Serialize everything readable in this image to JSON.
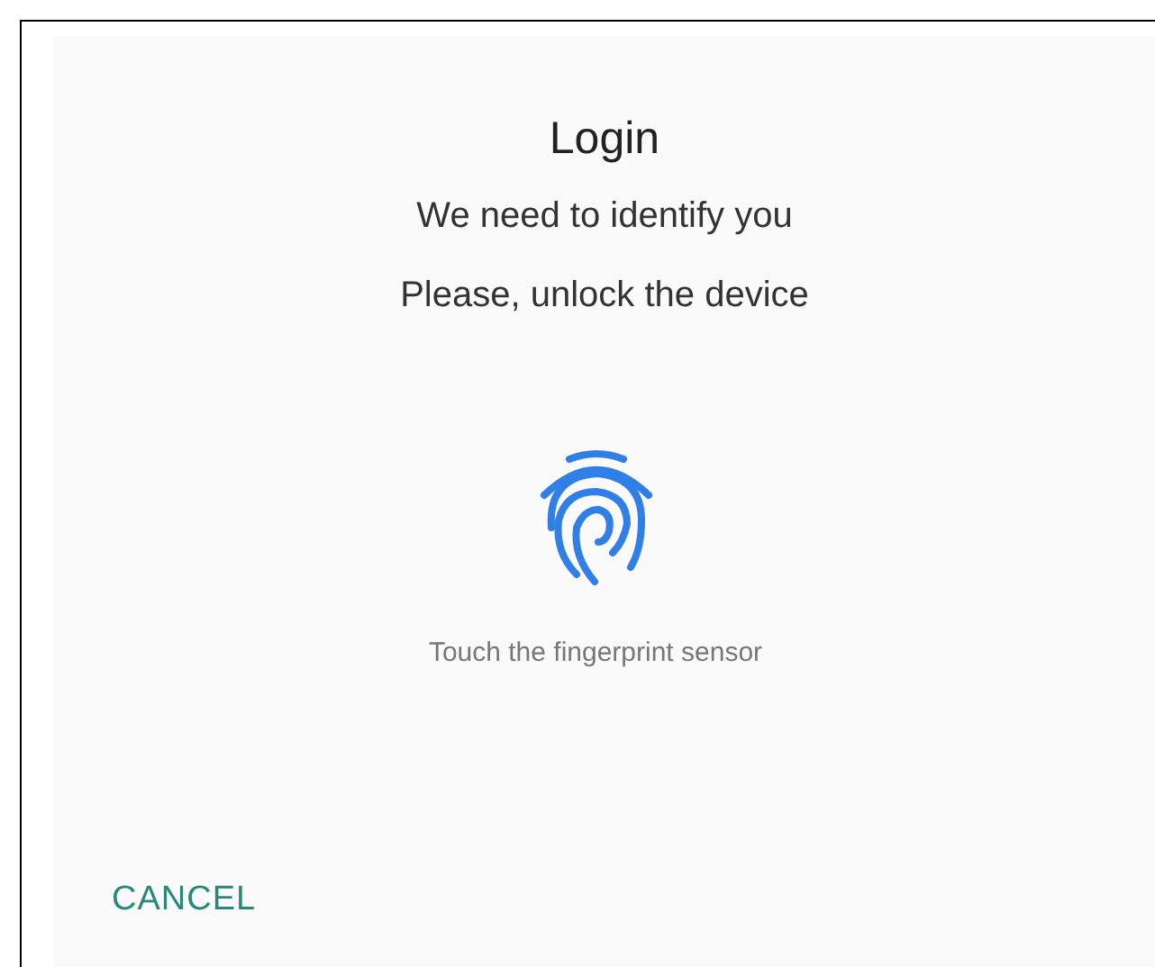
{
  "dialog": {
    "title": "Login",
    "subtitle": "We need to identify you",
    "description": "Please, unlock the device",
    "hint": "Touch the fingerprint sensor",
    "buttons": [
      {
        "label": "CANCEL",
        "kind": "text"
      }
    ]
  }
}
